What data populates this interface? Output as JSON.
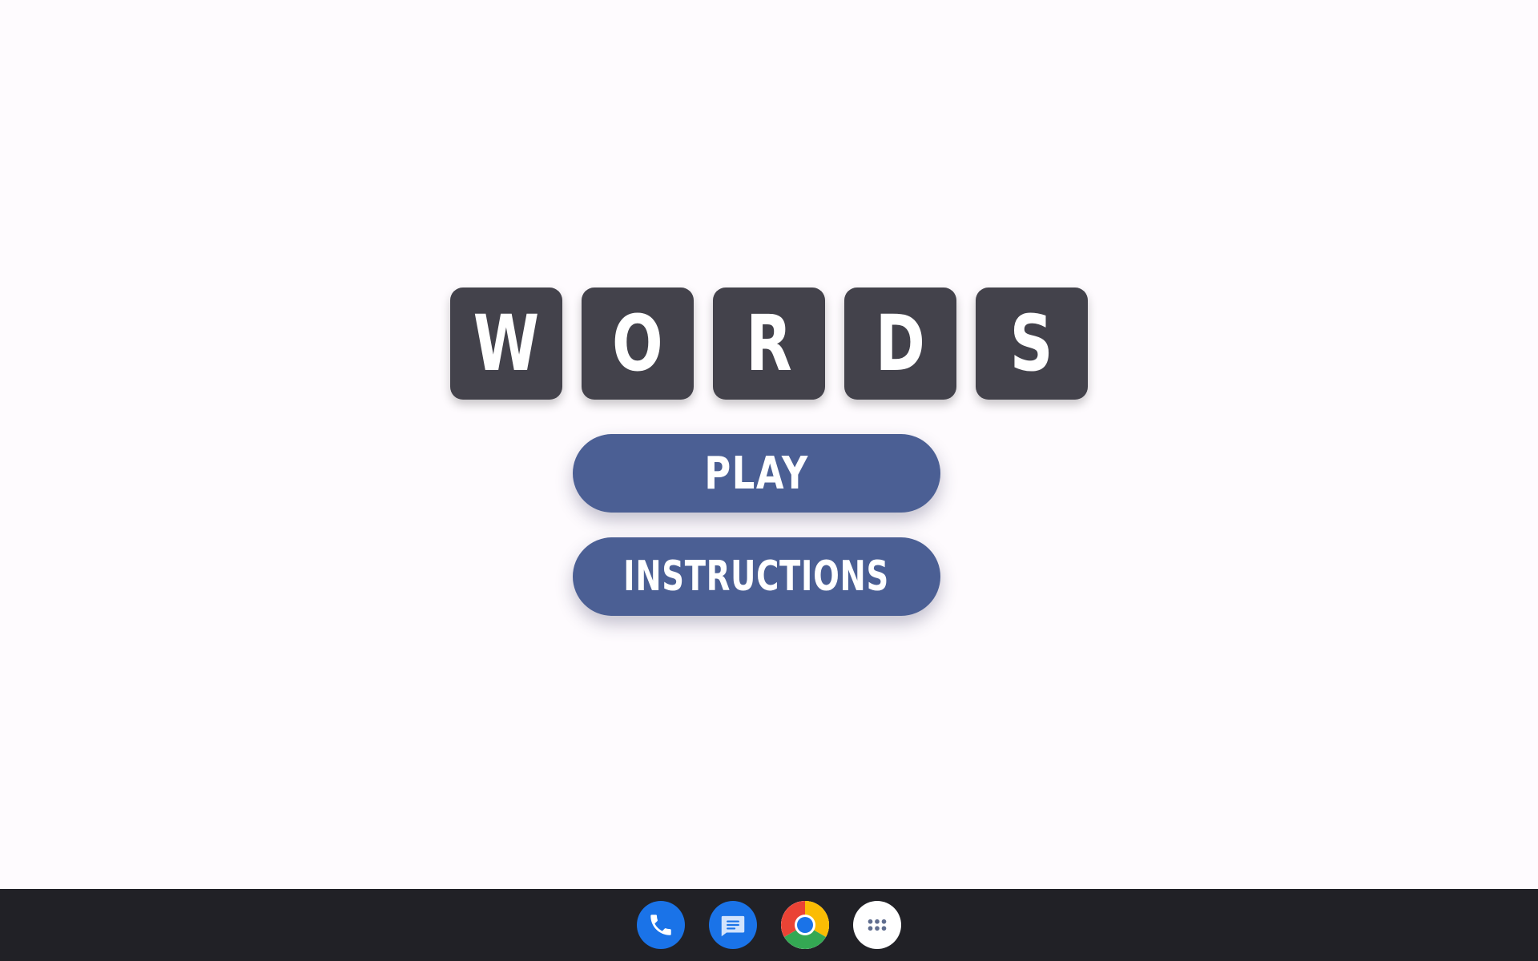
{
  "colors": {
    "background": "#fefbfe",
    "tile": "#43424b",
    "button": "#4b5f94",
    "taskbar": "#212126"
  },
  "title": {
    "letters": [
      "W",
      "O",
      "R",
      "D",
      "S"
    ]
  },
  "menu": {
    "play_label": "PLAY",
    "instructions_label": "INSTRUCTIONS"
  },
  "taskbar": {
    "apps": [
      {
        "icon": "phone-icon",
        "color": "#1a73e8"
      },
      {
        "icon": "messages-icon",
        "color": "#1a73e8"
      },
      {
        "icon": "chrome-icon",
        "color": "#ffffff"
      },
      {
        "icon": "app-launcher-icon",
        "color": "#ffffff"
      }
    ]
  }
}
